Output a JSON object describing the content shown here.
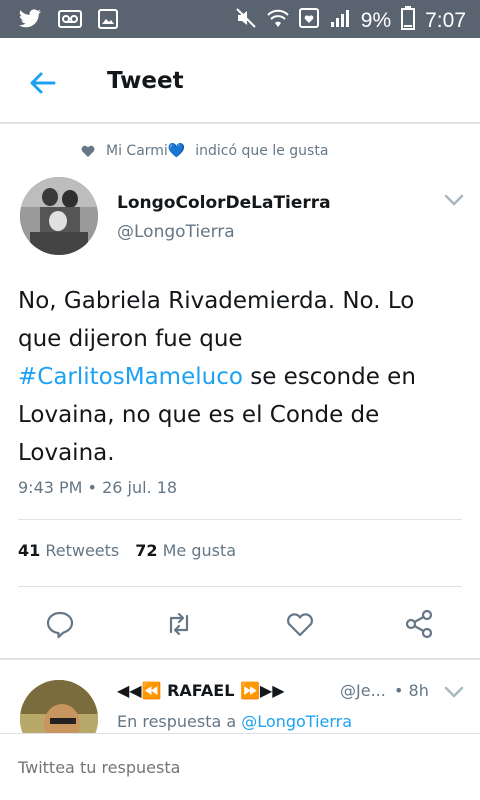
{
  "status_bar": {
    "battery_percent": "9%",
    "time": "7:07",
    "colors": {
      "background": "#5a6470"
    }
  },
  "header": {
    "title": "Tweet"
  },
  "social_context": {
    "text": "Mi Carmi",
    "suffix": "indicó que le gusta"
  },
  "tweet": {
    "author_name": "LongoColorDeLaTierra",
    "author_handle": "@LongoTierra",
    "text_before": "No, Gabriela Rivademierda. No. Lo que dijeron fue que ",
    "hashtag": "#CarlitosMameluco",
    "text_after": " se esconde en Lovaina, no que es el Conde de Lovaina.",
    "timestamp": "9:43 PM • 26 jul. 18",
    "retweets_count": "41",
    "retweets_label": "Retweets",
    "likes_count": "72",
    "likes_label": "Me gusta"
  },
  "reply": {
    "name": "◀◀⏪ RAFAEL ⏩▶▶",
    "handle": "@Je...",
    "time": "• 8h",
    "in_reply_to_label": "En respuesta a",
    "in_reply_to_handle": "@LongoTierra"
  },
  "compose": {
    "placeholder": "Twittea tu respuesta"
  },
  "colors": {
    "accent": "#1da1f2",
    "secondary_text": "#657786"
  }
}
